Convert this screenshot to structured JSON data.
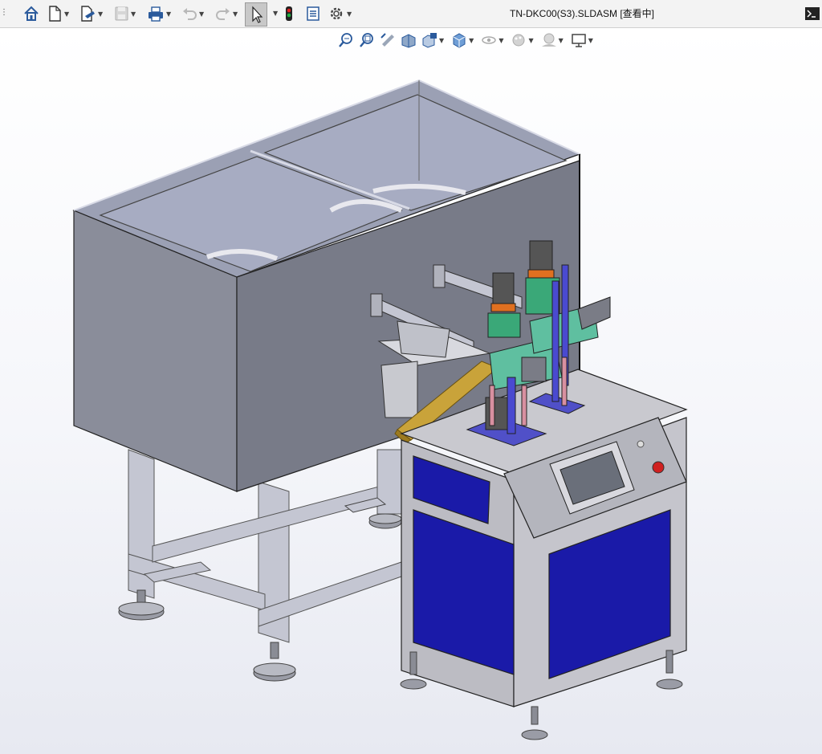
{
  "app": {
    "document_title": "TN-DKC00(S3).SLDASM [查看中]",
    "command_icon": "terminal-icon"
  },
  "toolbar": [
    {
      "name": "home-icon"
    },
    {
      "name": "new-document-icon",
      "dropdown": true
    },
    {
      "name": "open-document-icon",
      "dropdown": true
    },
    {
      "name": "save-icon",
      "dropdown": true,
      "disabled": true
    },
    {
      "name": "print-icon",
      "dropdown": true
    },
    {
      "name": "undo-icon",
      "dropdown": true,
      "disabled": true
    },
    {
      "name": "redo-icon",
      "dropdown": true,
      "disabled": true
    },
    {
      "name": "select-pointer-icon",
      "dropdown": true,
      "active": true
    },
    {
      "name": "rebuild-traffic-light-icon"
    },
    {
      "name": "file-properties-icon"
    },
    {
      "name": "options-gear-icon",
      "dropdown": true
    }
  ],
  "heads_up_toolbar": [
    {
      "name": "zoom-to-fit-icon"
    },
    {
      "name": "zoom-to-area-icon"
    },
    {
      "name": "previous-view-icon"
    },
    {
      "name": "section-view-icon"
    },
    {
      "name": "view-orientation-icon",
      "dropdown": true
    },
    {
      "name": "display-style-icon",
      "dropdown": true
    },
    {
      "name": "hide-show-items-icon",
      "dropdown": true
    },
    {
      "name": "edit-appearance-icon",
      "dropdown": true
    },
    {
      "name": "apply-scene-icon",
      "dropdown": true
    },
    {
      "name": "view-settings-icon",
      "dropdown": true
    }
  ],
  "colors": {
    "toolbar_bg": "#f3f3f3",
    "icon_blue": "#2a5a9c",
    "enclosure_gray": "#8a8d9a",
    "enclosure_dark": "#6e707d",
    "frame_steel": "#c4c6d2",
    "panel_blue": "#1a1aa8",
    "cabinet_gray": "#c9c9cf",
    "chute_gold": "#c9a33a",
    "mechanism_green": "#3aa878",
    "hmi_screen": "#6a6f7a",
    "estop_red": "#d02020"
  }
}
